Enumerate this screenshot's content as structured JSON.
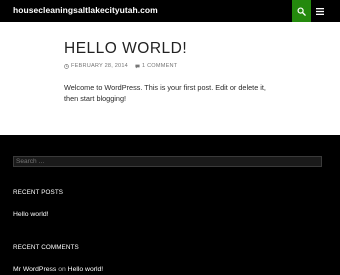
{
  "header": {
    "site_title": "housecleaningsaltlakecityutah.com",
    "search_icon": "search-icon",
    "menu_icon": "hamburger-menu-icon",
    "accent_color": "#24890d"
  },
  "post": {
    "title": "HELLO WORLD!",
    "date": "FEBRUARY 28, 2014",
    "comments": "1 COMMENT",
    "body": "Welcome to WordPress. This is your first post. Edit or delete it, then start blogging!"
  },
  "footer": {
    "search_placeholder": "Search …",
    "recent_posts": {
      "title": "RECENT POSTS",
      "items": [
        "Hello world!"
      ]
    },
    "recent_comments": {
      "title": "RECENT COMMENTS",
      "author": "Mr WordPress",
      "on_text": "on",
      "post": "Hello world!"
    }
  }
}
